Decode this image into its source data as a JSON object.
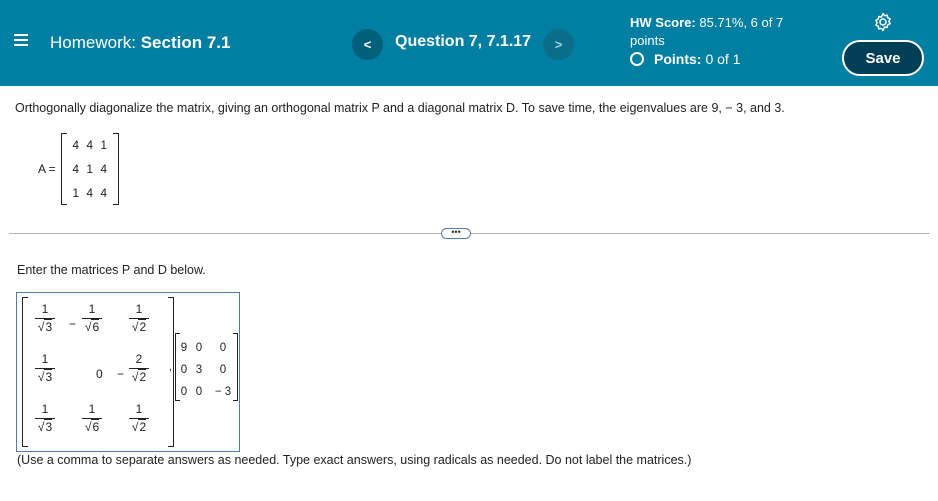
{
  "header": {
    "title_prefix": "Homework:",
    "title_section": "Section 7.1",
    "question_label": "Question 7, 7.1.17",
    "prev_glyph": "<",
    "next_glyph": ">",
    "hw_score_label": "HW Score:",
    "hw_score_value": "85.71%, 6 of 7",
    "hw_score_unit": "points",
    "points_label": "Points:",
    "points_value": "0 of 1",
    "save_label": "Save",
    "menu_icon": "hamburger-icon",
    "settings_icon": "gear-icon"
  },
  "question": {
    "prompt": "Orthogonally diagonalize the matrix, giving an orthogonal matrix P and a diagonal matrix D. To save time, the eigenvalues are 9, − 3, and 3.",
    "matrix_label": "A =",
    "matrix_a": [
      [
        "4",
        "4",
        "1"
      ],
      [
        "4",
        "1",
        "4"
      ],
      [
        "1",
        "4",
        "4"
      ]
    ],
    "more_glyph": "•••",
    "instruction": "Enter the matrices P and D below.",
    "hint": "(Use a comma to separate answers as needed. Type exact answers, using radicals as needed. Do not label the matrices.)"
  },
  "answer": {
    "p_entries": {
      "r1c1_num": "1",
      "r1c1_den": "3",
      "r1c2_sign": "−",
      "r1c2_num": "1",
      "r1c2_den": "6",
      "r1c3_num": "1",
      "r1c3_den": "2",
      "r2c1_num": "1",
      "r2c1_den": "3",
      "r2c2": "0",
      "r2c3_sign": "−",
      "r2c3_num": "2",
      "r2c3_den": "2",
      "r3c1_num": "1",
      "r3c1_den": "3",
      "r3c2_num": "1",
      "r3c2_den": "6",
      "r3c3_num": "1",
      "r3c3_den": "2"
    },
    "separator": ",",
    "radical_glyph": "√",
    "d_matrix": [
      [
        "9",
        "0",
        "0"
      ],
      [
        "0",
        "3",
        "0"
      ],
      [
        "0",
        "0",
        "− 3"
      ]
    ]
  }
}
